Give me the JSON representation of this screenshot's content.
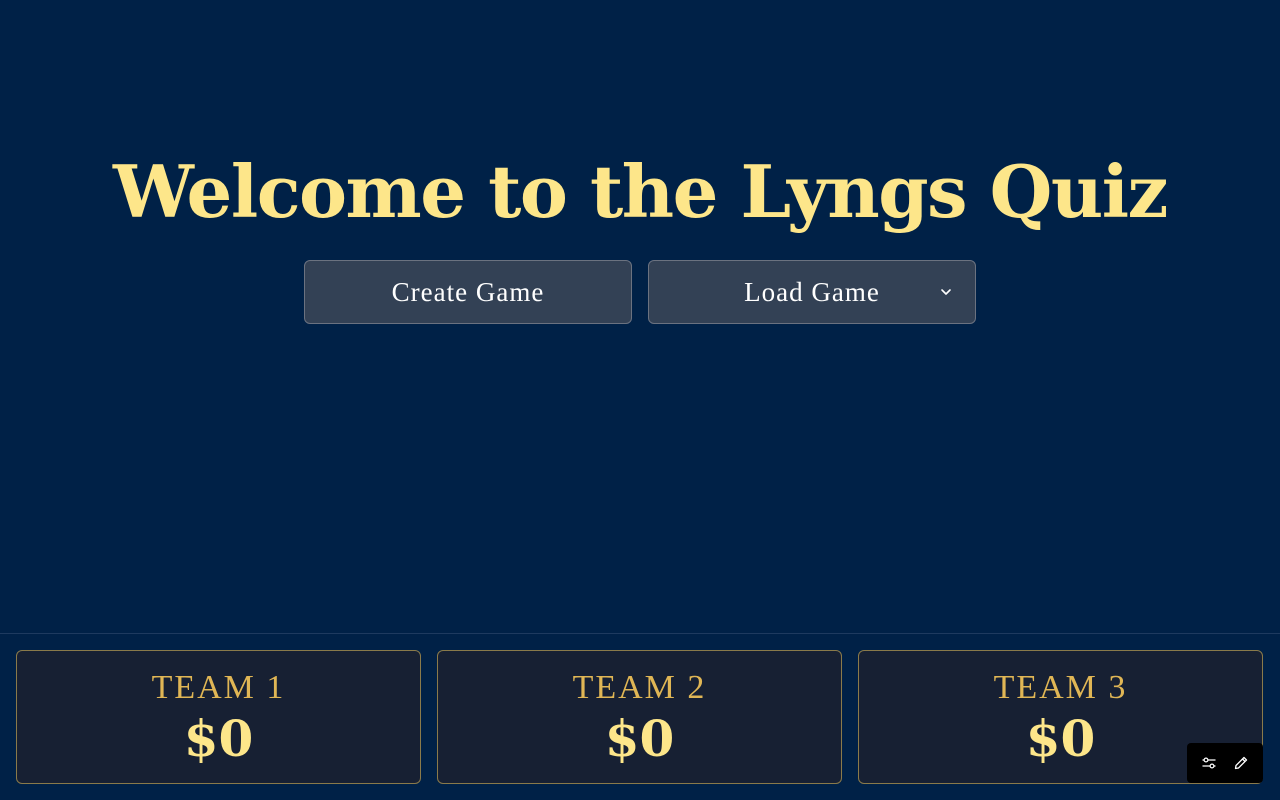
{
  "hero": {
    "title": "Welcome to the Lyngs Quiz",
    "create_label": "Create Game",
    "load_label": "Load Game"
  },
  "teams": [
    {
      "name": "TEAM 1",
      "score": "$0"
    },
    {
      "name": "TEAM 2",
      "score": "$0"
    },
    {
      "name": "TEAM 3",
      "score": "$0"
    }
  ],
  "toolbar": {
    "icons": [
      "sliders-icon",
      "pencil-icon"
    ]
  },
  "colors": {
    "background": "#002147",
    "title": "#fde68a",
    "button_bg": "#334155",
    "team_name": "#e0b655",
    "team_border": "#8a7a4a"
  }
}
